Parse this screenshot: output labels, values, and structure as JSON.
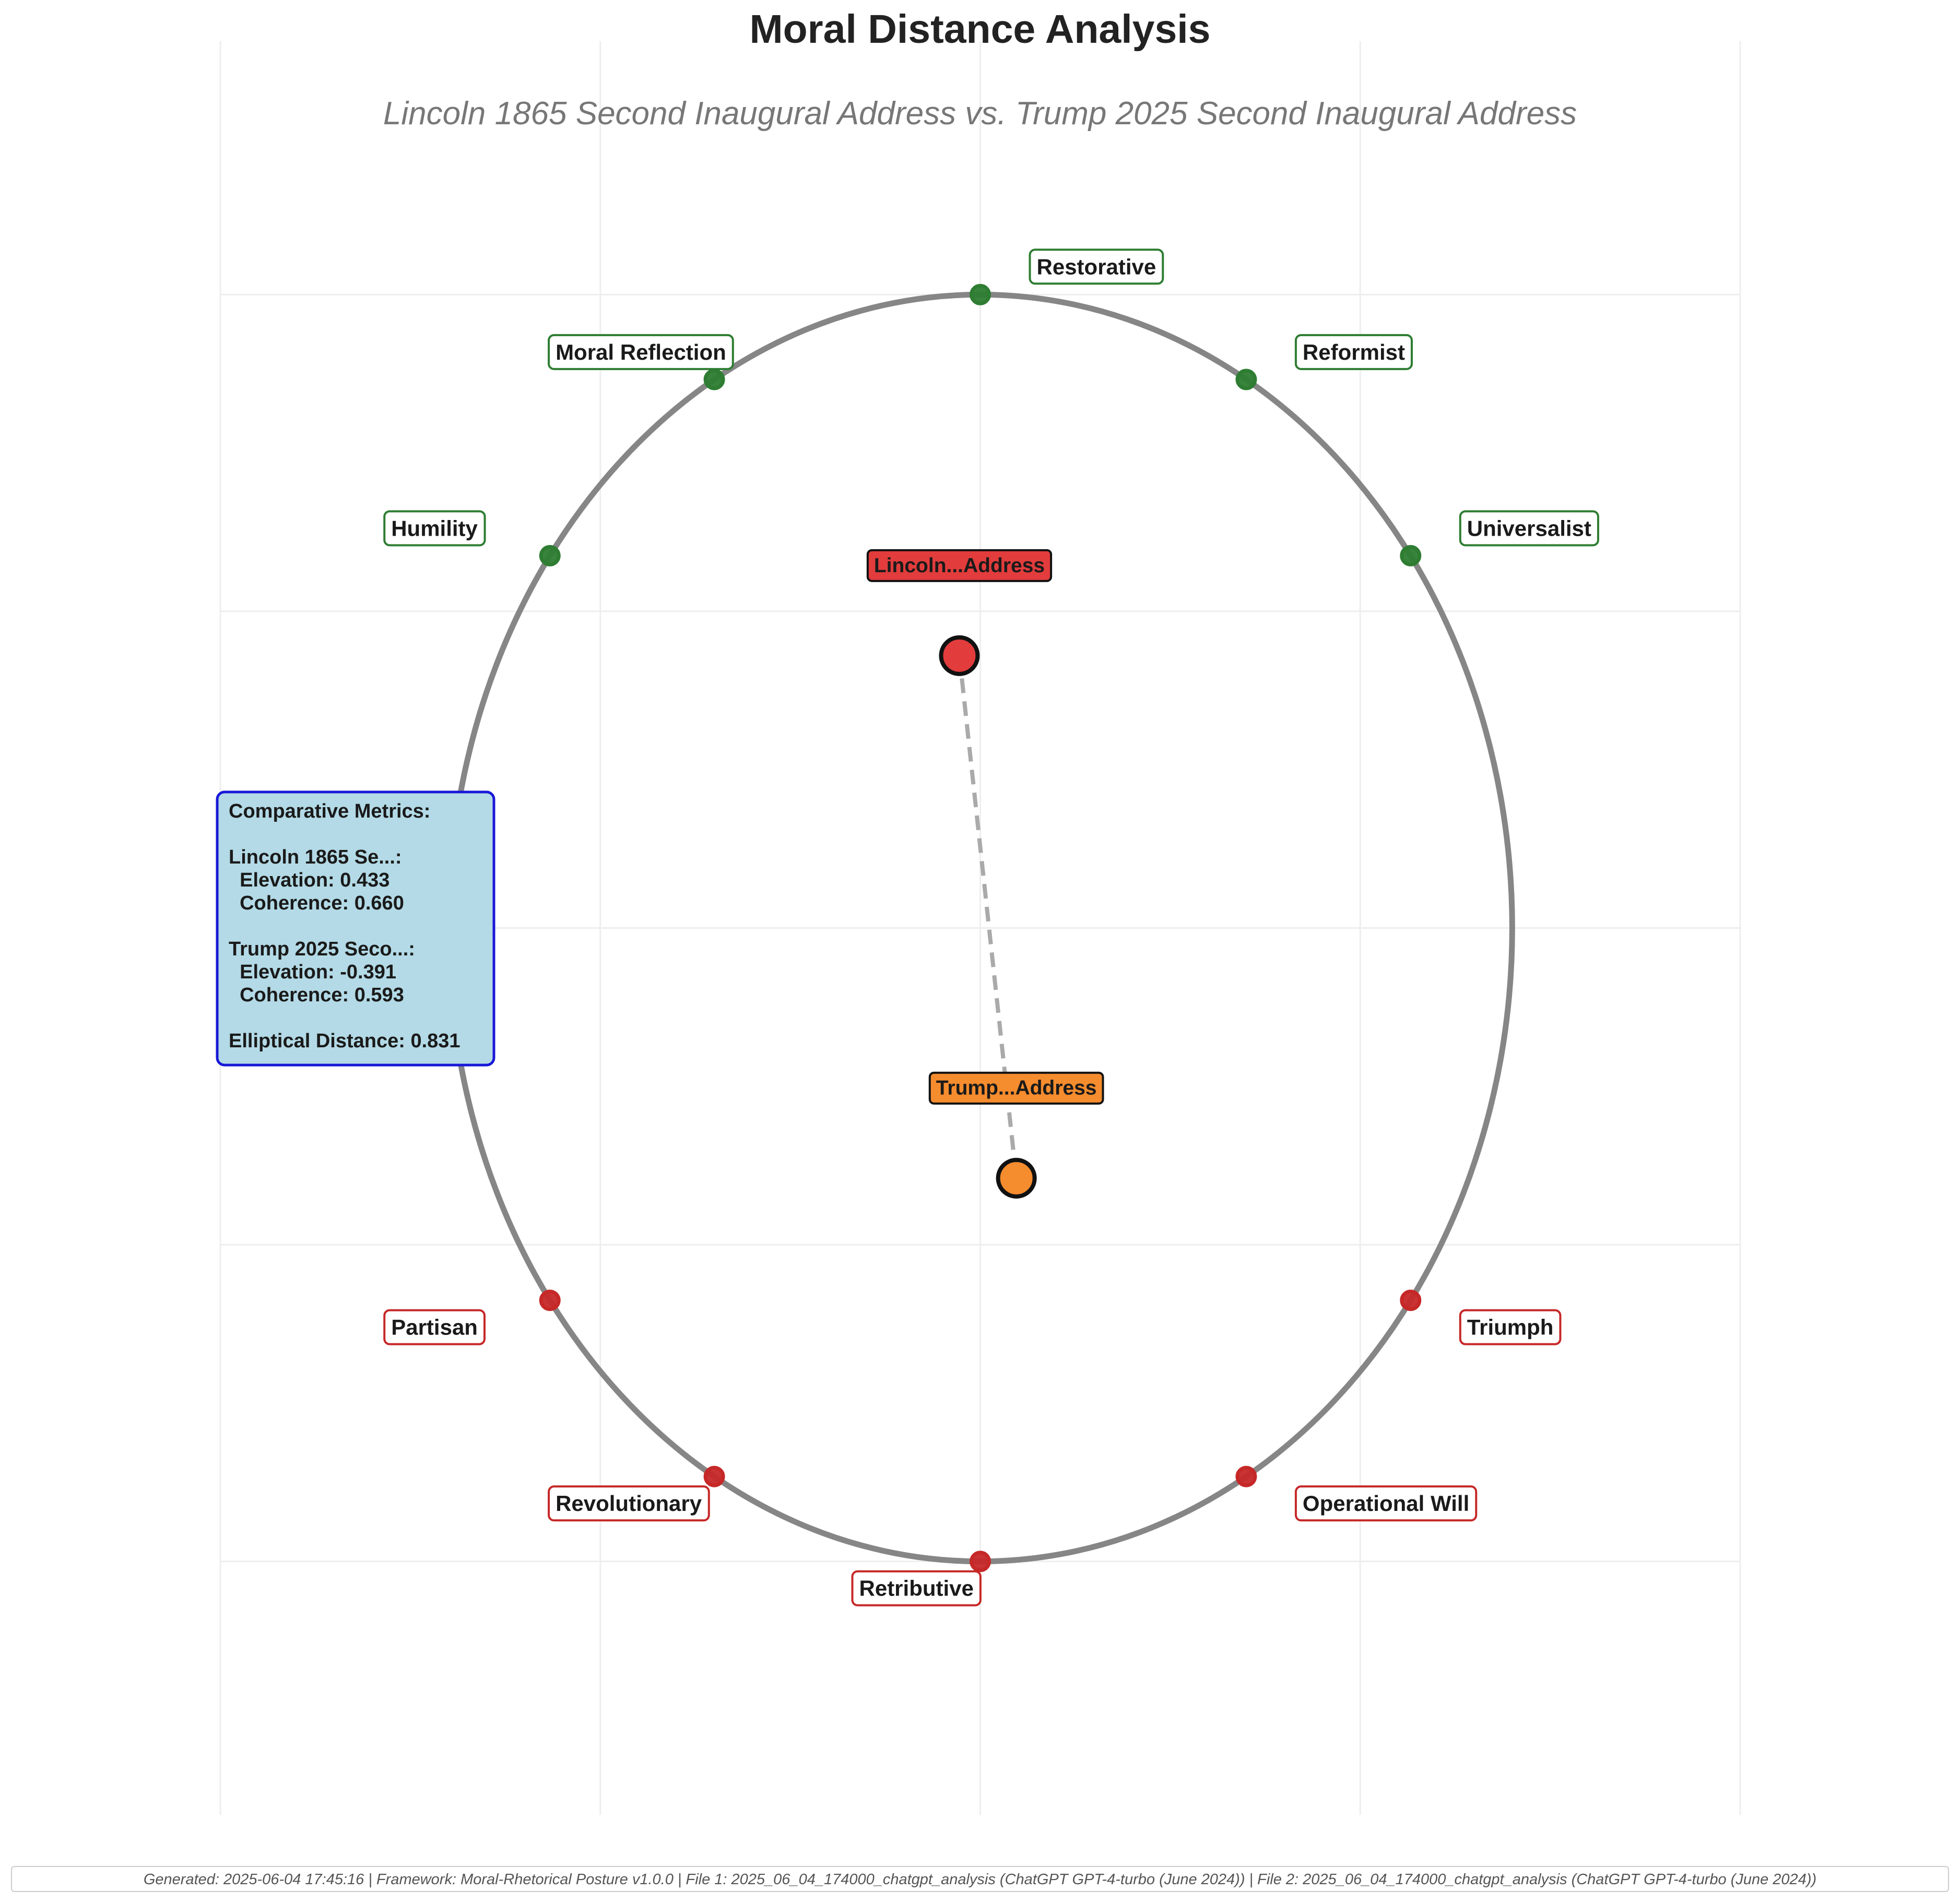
{
  "chart_data": {
    "type": "scatter",
    "title": "Moral Distance Analysis",
    "subtitle": "Lincoln 1865 Second Inaugural Address vs. Trump 2025 Second Inaugural Address",
    "xlim": [
      -2.0,
      2.0
    ],
    "ylim": [
      -2.8,
      2.8
    ],
    "grid": true,
    "ellipse": {
      "rx": 1.4,
      "ry": 2.0,
      "color": "#808080"
    },
    "anchors": [
      {
        "label": "Restorative",
        "angle": 90,
        "group": "positive",
        "label_side": "right"
      },
      {
        "label": "Reformist",
        "angle": 60,
        "group": "positive",
        "label_side": "right"
      },
      {
        "label": "Universalist",
        "angle": 36,
        "group": "positive",
        "label_side": "right"
      },
      {
        "label": "Moral Reflection",
        "angle": 120,
        "group": "positive",
        "label_side": "left"
      },
      {
        "label": "Humility",
        "angle": 144,
        "group": "positive",
        "label_side": "left"
      },
      {
        "label": "Partisan",
        "angle": 216,
        "group": "negative",
        "label_side": "left"
      },
      {
        "label": "Revolutionary",
        "angle": 240,
        "group": "negative",
        "label_side": "left"
      },
      {
        "label": "Retributive",
        "angle": 270,
        "group": "negative",
        "label_side": "left"
      },
      {
        "label": "Operational Will",
        "angle": 300,
        "group": "negative",
        "label_side": "right"
      },
      {
        "label": "Triumph",
        "angle": 324,
        "group": "negative",
        "label_side": "right"
      }
    ],
    "anchor_colors": {
      "positive": "#2e7d32",
      "negative": "#c62828"
    },
    "points": [
      {
        "label": "Lincoln...Address",
        "x": -0.055,
        "y": 0.86,
        "color": "#e23c3c"
      },
      {
        "label": "Trump...Address",
        "x": 0.095,
        "y": -0.79,
        "color": "#f58c2e"
      }
    ],
    "connector": {
      "color": "#aaaaaa",
      "style": "dashed"
    }
  },
  "metrics": {
    "lines": [
      "Comparative Metrics:",
      "",
      "Lincoln 1865 Se...:",
      "  Elevation: 0.433",
      "  Coherence: 0.660",
      "",
      "Trump 2025 Seco...:",
      "  Elevation: -0.391",
      "  Coherence: 0.593",
      "",
      "Elliptical Distance: 0.831"
    ],
    "box_color": "#b3dae6",
    "border_color": "#1818d8"
  },
  "footer": {
    "text": "Generated: 2025-06-04 17:45:16 | Framework: Moral-Rhetorical Posture v1.0.0 | File 1: 2025_06_04_174000_chatgpt_analysis (ChatGPT GPT-4-turbo (June 2024)) | File 2: 2025_06_04_174000_chatgpt_analysis (ChatGPT GPT-4-turbo (June 2024))"
  }
}
